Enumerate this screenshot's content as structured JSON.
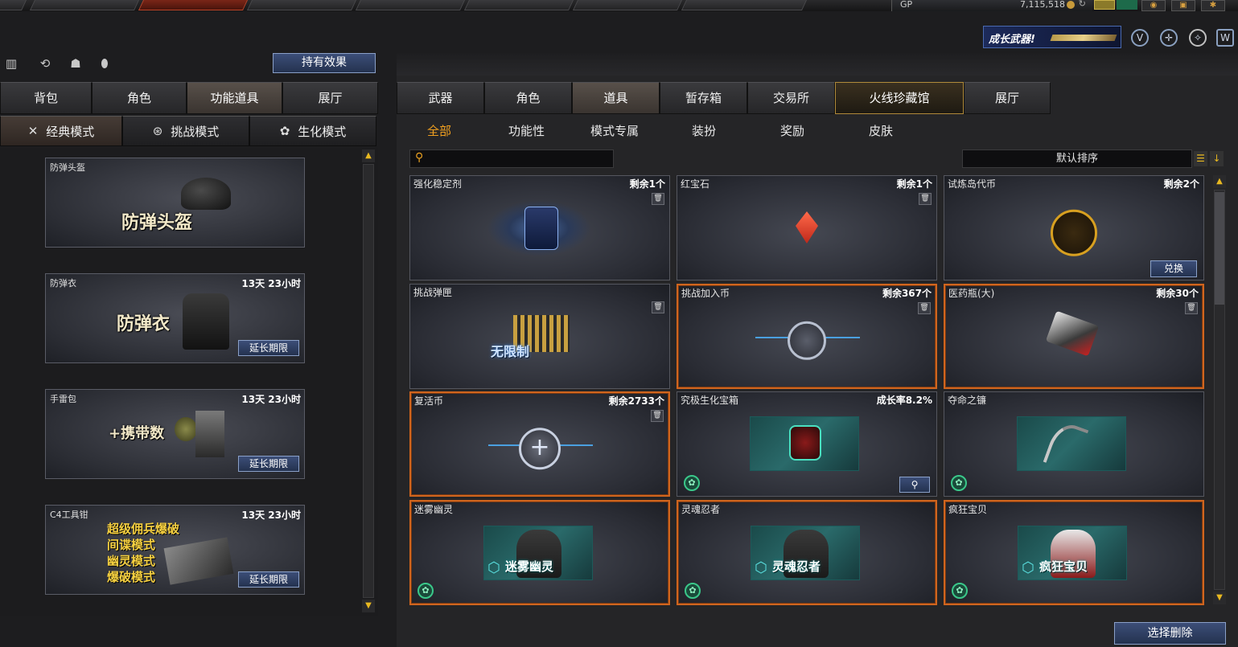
{
  "topbar": {
    "gp_label": "GP",
    "gp_value": "7,115,518"
  },
  "promo": {
    "text": "成长武器!"
  },
  "left": {
    "effect_button": "持有效果",
    "tabs": [
      {
        "label": "背包"
      },
      {
        "label": "角色"
      },
      {
        "label": "功能道具"
      },
      {
        "label": "展厅"
      }
    ],
    "modes": [
      {
        "label": "经典模式",
        "icon": "crossed-swords-icon"
      },
      {
        "label": "挑战模式",
        "icon": "challenge-icon"
      },
      {
        "label": "生化模式",
        "icon": "biohazard-icon"
      }
    ],
    "items": [
      {
        "name": "防弹头盔",
        "big_text": "防弹头盔",
        "time": "",
        "button": ""
      },
      {
        "name": "防弹衣",
        "big_text": "防弹衣",
        "time": "13天 23小时",
        "button": "延长期限"
      },
      {
        "name": "手雷包",
        "big_text": "+携带数",
        "time": "13天 23小时",
        "button": "延长期限"
      },
      {
        "name": "C4工具钳",
        "big_text": "",
        "time": "13天 23小时",
        "button": "延长期限",
        "lines": [
          "超级佣兵爆破",
          "间谍模式",
          "幽灵模式",
          "爆破模式"
        ]
      }
    ]
  },
  "right": {
    "tabs": [
      {
        "label": "武器"
      },
      {
        "label": "角色"
      },
      {
        "label": "道具"
      },
      {
        "label": "暂存箱"
      },
      {
        "label": "交易所"
      },
      {
        "label": "火线珍藏馆"
      },
      {
        "label": "展厅"
      }
    ],
    "sub_tabs": [
      {
        "label": "全部"
      },
      {
        "label": "功能性"
      },
      {
        "label": "模式专属"
      },
      {
        "label": "装扮"
      },
      {
        "label": "奖励"
      },
      {
        "label": "皮肤"
      }
    ],
    "search_placeholder": "",
    "sort_label": "默认排序",
    "items": [
      {
        "name": "强化稳定剂",
        "count": "剩余1个"
      },
      {
        "name": "红宝石",
        "count": "剩余1个"
      },
      {
        "name": "试炼岛代币",
        "count": "剩余2个",
        "button": "兑换"
      },
      {
        "name": "挑战弹匣",
        "count": "",
        "art_text": "无限制"
      },
      {
        "name": "挑战加入币",
        "count": "剩余367个"
      },
      {
        "name": "医药瓶(大)",
        "count": "剩余30个"
      },
      {
        "name": "复活币",
        "count": "剩余2733个"
      },
      {
        "name": "究极生化宝箱",
        "count": "成长率8.2%"
      },
      {
        "name": "夺命之镰",
        "count": ""
      },
      {
        "name": "迷雾幽灵",
        "count": "",
        "art_text": "迷雾幽灵"
      },
      {
        "name": "灵魂忍者",
        "count": "",
        "art_text": "灵魂忍者"
      },
      {
        "name": "疯狂宝贝",
        "count": "",
        "art_text": "疯狂宝贝"
      }
    ],
    "delete_button": "选择删除"
  }
}
